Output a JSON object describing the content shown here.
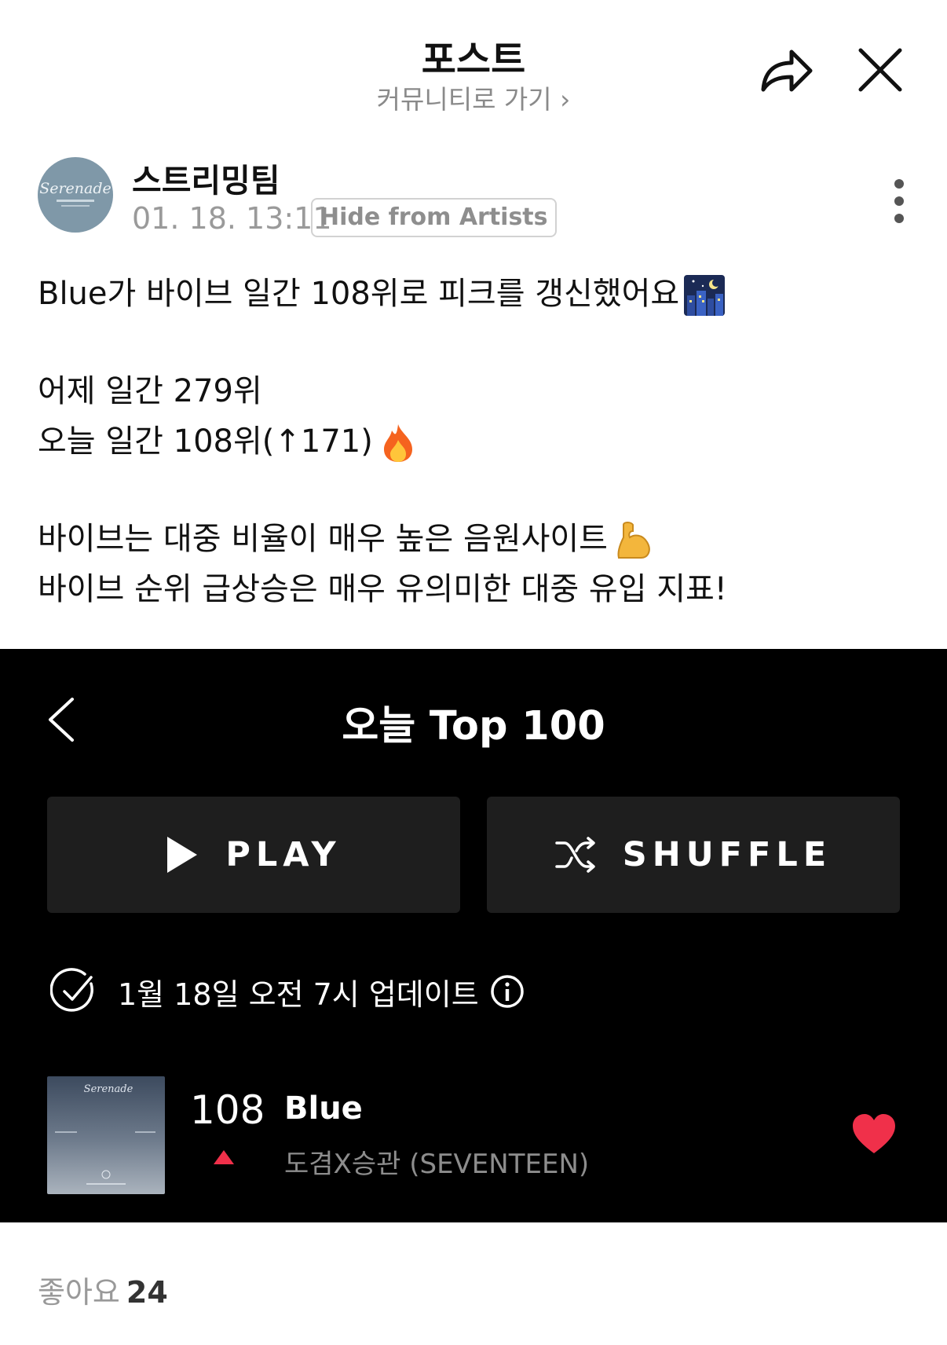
{
  "header": {
    "title": "포스트",
    "community_link": "커뮤니티로 가기 ›"
  },
  "author": {
    "name": "스트리밍팀",
    "avatar_text": "Serenade",
    "time": "01. 18. 13:11",
    "hide_badge": "Hide from Artists"
  },
  "post": {
    "line1": "Blue가 바이브 일간 108위로 피크를 갱신했어요",
    "line2": "어제 일간 279위",
    "line3": "오늘 일간 108위(↑171)",
    "line4": "바이브는 대중 비율이 매우 높은 음원사이트",
    "line5": "바이브 순위 급상승은 매우 유의미한 대중 유입 지표!",
    "emoji1": "city-night-emoji",
    "emoji2": "fire-emoji",
    "emoji3": "flexed-biceps-emoji"
  },
  "card": {
    "title": "오늘 Top 100",
    "play_label": "PLAY",
    "shuffle_label": "SHUFFLE",
    "update_text": "1월 18일 오전 7시 업데이트",
    "track": {
      "rank": "108",
      "title": "Blue",
      "artist": "도겸X승관 (SEVENTEEN)",
      "album_art_text": "Serenade",
      "trend": "up"
    }
  },
  "footer": {
    "likes_label": "좋아요",
    "likes_count": "24"
  },
  "colors": {
    "card_bg": "#000000",
    "button_bg": "#1e1e1e",
    "heart": "#f0304a",
    "rank_up": "#f0304a",
    "muted_text": "#8a8a8a"
  }
}
